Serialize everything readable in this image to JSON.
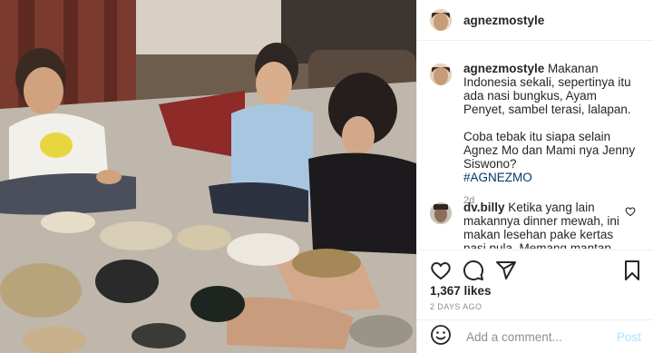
{
  "post": {
    "username": "agnezmostyle",
    "caption_p1": "Makanan Indonesia sekali, sepertinya itu ada nasi bungkus, Ayam Penyet, sambel terasi, lalapan.",
    "caption_p2": "Coba tebak itu siapa selain Agnez Mo dan Mami nya Jenny Siswono?",
    "hashtag": "#AGNEZMO",
    "age": "2d"
  },
  "comment": {
    "username": "dv.billy",
    "text": "Ketika yang lain makannya dinner mewah, ini makan lesehan pake kertas nasi pula. Memang mantap agnes ini."
  },
  "actions": {
    "likes": "1,367 likes",
    "date": "2 DAYS AGO"
  },
  "add_comment": {
    "placeholder": "Add a comment...",
    "post_label": "Post"
  },
  "icons": {
    "like": "heart-icon",
    "comment": "comment-icon",
    "share": "share-icon",
    "save": "bookmark-icon",
    "emoji": "emoji-icon",
    "comment_like": "heart-icon"
  },
  "colors": {
    "hashtag": "#00376b",
    "post_button": "#b2dffc",
    "secondary_text": "#8e8e8e"
  }
}
